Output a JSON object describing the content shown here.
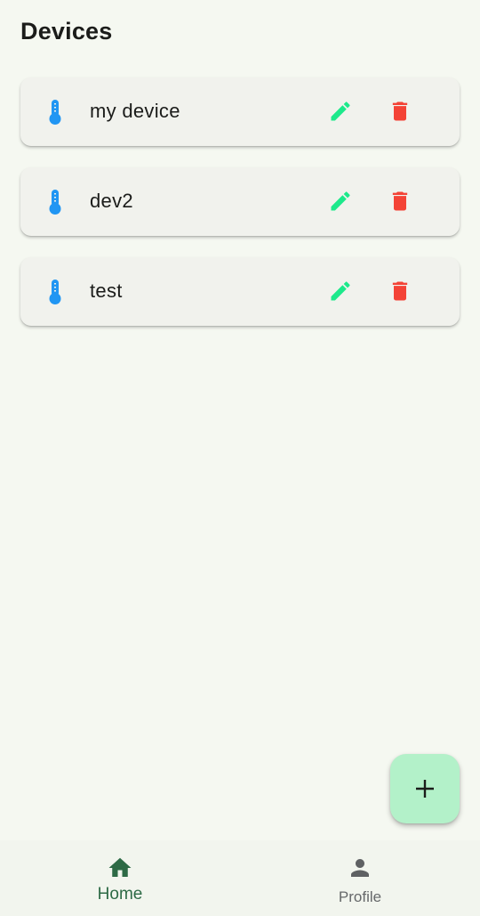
{
  "header": {
    "title": "Devices"
  },
  "devices": [
    {
      "name": "my device",
      "icon": "thermometer-icon"
    },
    {
      "name": "dev2",
      "icon": "thermometer-icon"
    },
    {
      "name": "test",
      "icon": "thermometer-icon"
    }
  ],
  "actions": {
    "edit_icon": "pencil-icon",
    "delete_icon": "trash-icon",
    "add_icon": "plus-icon"
  },
  "bottom_nav": {
    "items": [
      {
        "label": "Home",
        "icon": "home-icon",
        "active": true
      },
      {
        "label": "Profile",
        "icon": "person-icon",
        "active": false
      }
    ]
  },
  "colors": {
    "background": "#f5f8f1",
    "card": "#f1f2ed",
    "thermometer": "#2196f3",
    "edit": "#1de98b",
    "delete": "#f44336",
    "fab": "#b3f1c9",
    "nav_active": "#2d6a45",
    "nav_inactive": "#66686a"
  }
}
